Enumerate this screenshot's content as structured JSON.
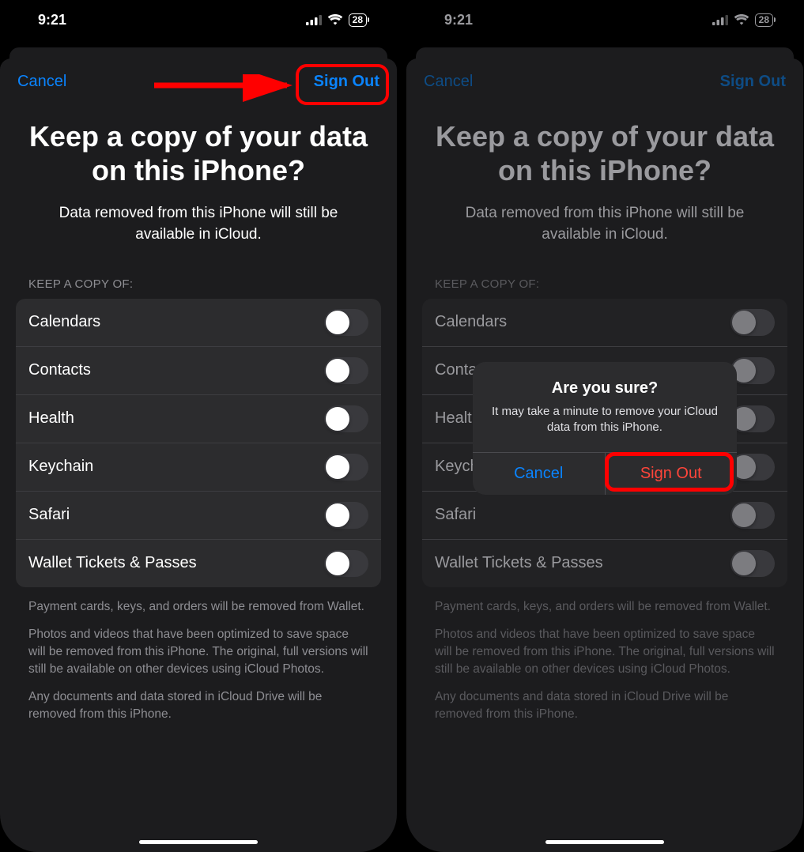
{
  "status": {
    "time": "9:21",
    "battery": "28"
  },
  "sheet": {
    "cancel": "Cancel",
    "confirm": "Sign Out",
    "title": "Keep a copy of your data on this iPhone?",
    "subtitle": "Data removed from this iPhone will still be available in iCloud.",
    "section_header": "KEEP A COPY OF:",
    "items": [
      {
        "label": "Calendars"
      },
      {
        "label": "Contacts"
      },
      {
        "label": "Health"
      },
      {
        "label": "Keychain"
      },
      {
        "label": "Safari"
      },
      {
        "label": "Wallet Tickets & Passes"
      }
    ],
    "footer1": "Payment cards, keys, and orders will be removed from Wallet.",
    "footer2": "Photos and videos that have been optimized to save space will be removed from this iPhone. The original, full versions will still be available on other devices using iCloud Photos.",
    "footer3": "Any documents and data stored in iCloud Drive will be removed from this iPhone."
  },
  "alert": {
    "title": "Are you sure?",
    "message": "It may take a minute to remove your iCloud data from this iPhone.",
    "cancel": "Cancel",
    "confirm": "Sign Out"
  }
}
